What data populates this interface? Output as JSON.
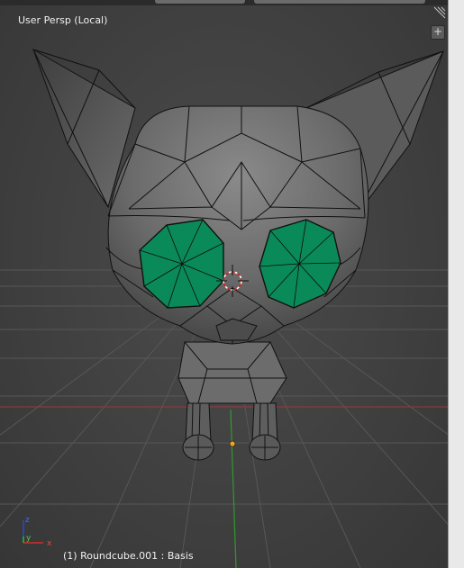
{
  "viewport": {
    "view_name": "User Persp (Local)",
    "object_info": "(1) Roundcube.001 : Basis"
  },
  "axes_gizmo": {
    "x": "x",
    "y": "y",
    "z": "z"
  },
  "widgets": {
    "properties_toggle": "+"
  },
  "colors": {
    "background": "#404040",
    "grid_line": "#5a5a5a",
    "x_axis": "#8a3a3a",
    "y_axis": "#3a8a3a",
    "mesh_face": "#6a6a6a",
    "mesh_edge": "#111111",
    "eye_fill": "#0a8a58",
    "origin_dot": "#f0a030"
  }
}
